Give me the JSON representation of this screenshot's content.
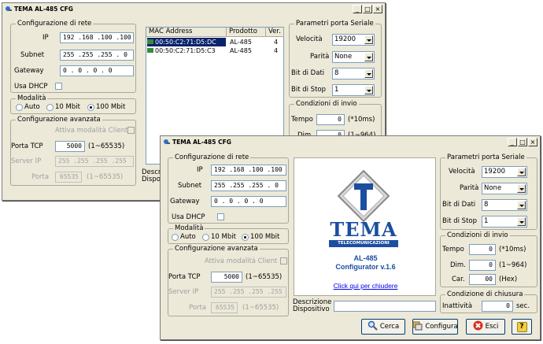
{
  "title": "TEMA AL-485 CFG",
  "window_buttons": {
    "min": "_",
    "max": "□",
    "close": "×"
  },
  "rete": {
    "legend": "Configurazione di rete",
    "ip_label": "IP",
    "ip": "192 .168 .100 .100",
    "subnet_label": "Subnet",
    "subnet": "255 .255 .255 .  0",
    "gateway_label": "Gateway",
    "gateway": "0  .  0  .  0  .  0",
    "dhcp_label": "Usa DHCP"
  },
  "modalita": {
    "legend": "Modalità",
    "auto": "Auto",
    "m10": "10 Mbit",
    "m100": "100 Mbit"
  },
  "avanzata": {
    "legend": "Configurazione avanzata",
    "client_label": "Attiva modalità Client",
    "porta_tcp_label": "Porta TCP",
    "porta_tcp": "5000",
    "porta_tcp_range": "(1~65535)",
    "server_ip_label": "Server IP",
    "server_ip": "255 .255 .255 .255",
    "porta_label": "Porta",
    "porta": "65535",
    "porta_range": "(1~65535)"
  },
  "list": {
    "headers": [
      "MAC Address",
      "Prodotto",
      "Ver."
    ],
    "rows": [
      {
        "mac": "00:50:C2:71:D5:DC",
        "prodotto": "AL-485",
        "ver": "4"
      },
      {
        "mac": "00:50:C2:71:D5:C3",
        "prodotto": "AL-485",
        "ver": "4"
      }
    ]
  },
  "seriale": {
    "legend": "Parametri porta Seriale",
    "velocita_label": "Velocità",
    "velocita": "19200",
    "parita_label": "Parità",
    "parita": "None",
    "bitdati_label": "Bit di Dati",
    "bitdati": "8",
    "bitstop_label": "Bit di Stop",
    "bitstop": "1"
  },
  "invio": {
    "legend": "Condizioni di invio",
    "tempo_label": "Tempo",
    "tempo": "0",
    "tempo_unit": "(*10ms)",
    "dim_label": "Dim.",
    "dim": "0",
    "dim_unit": "(1~964)",
    "car_label": "Car.",
    "car": "00",
    "car_unit": "(Hex)"
  },
  "chiusura": {
    "legend": "Condizione di chiusura",
    "inattivita_label": "Inattività",
    "inattivita": "0",
    "inattivita_unit": "sec."
  },
  "descrizione": {
    "label1": "Descrizione",
    "label2": "Dispositivo",
    "label1_short": "Descri",
    "label2_short": "Dispos"
  },
  "about": {
    "logo_text": "TEMA",
    "logo_sub": "TELECOMUNICAZIONI",
    "product": "AL-485",
    "version": "Configurator v.1.6",
    "close_link": "Click qui per chiudere"
  },
  "buttons": {
    "cerca": "Cerca",
    "configura": "Configura",
    "esci": "Esci",
    "help": "?"
  },
  "colors": {
    "accent": "#0a246a",
    "logo_blue": "#1c4ea0",
    "link": "#0000ee"
  }
}
